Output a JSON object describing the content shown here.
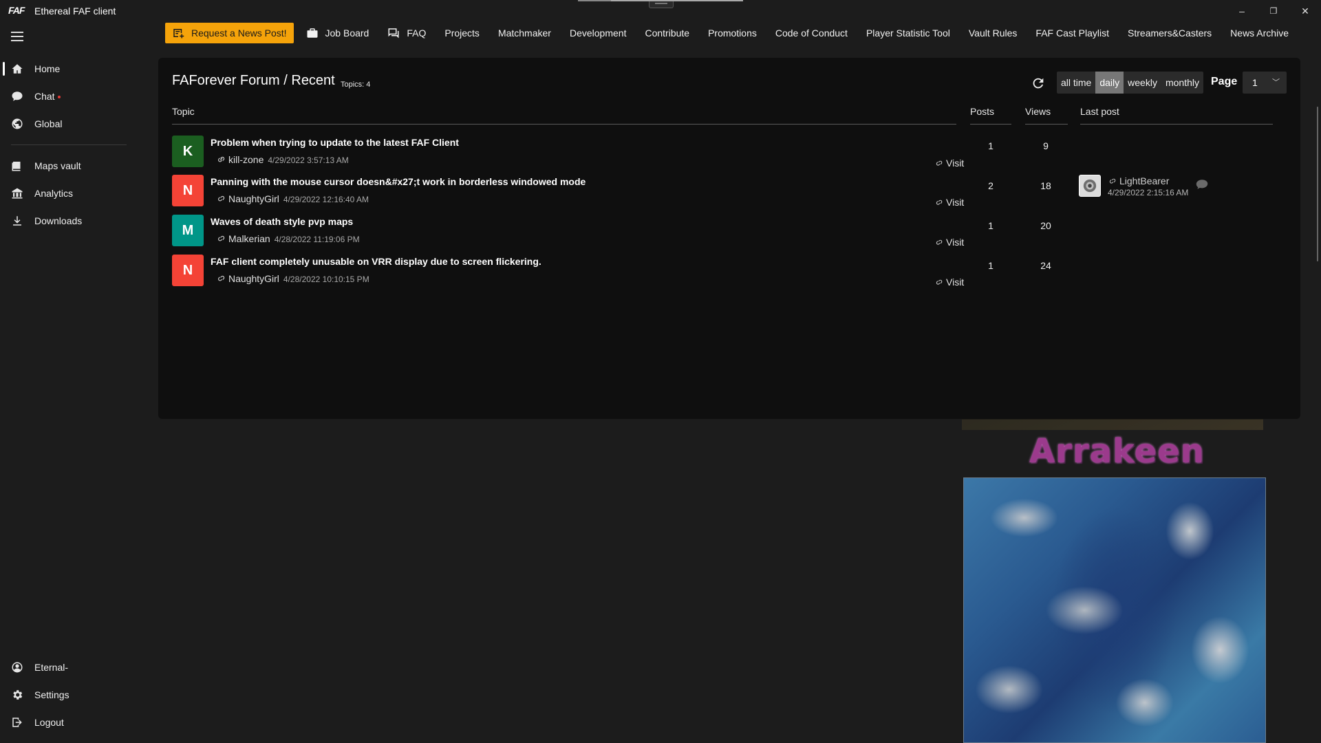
{
  "app": {
    "title": "Ethereal FAF client",
    "logo_text": "FAF"
  },
  "window_controls": {
    "minimize": "–",
    "maximize": "❐",
    "close": "✕"
  },
  "sidebar": {
    "items": [
      {
        "label": "Home",
        "icon": "home-icon"
      },
      {
        "label": "Chat",
        "icon": "chat-icon"
      },
      {
        "label": "Global",
        "icon": "globe-icon"
      },
      {
        "label": "Maps vault",
        "icon": "maps-icon"
      },
      {
        "label": "Analytics",
        "icon": "analytics-icon"
      },
      {
        "label": "Downloads",
        "icon": "download-icon"
      }
    ],
    "bottom_items": [
      {
        "label": "Eternal-",
        "icon": "user-icon"
      },
      {
        "label": "Settings",
        "icon": "gear-icon"
      },
      {
        "label": "Logout",
        "icon": "logout-icon"
      }
    ]
  },
  "topnav": {
    "news_button": "Request a News Post!",
    "tabs": [
      "Job Board",
      "FAQ",
      "Projects",
      "Matchmaker",
      "Development",
      "Contribute",
      "Promotions",
      "Code of Conduct",
      "Player Statistic Tool",
      "Vault Rules",
      "FAF Cast Playlist",
      "Streamers&Casters",
      "News Archive"
    ]
  },
  "forum": {
    "title": "FAForever Forum / Recent",
    "topics_count": "Topics: 4",
    "filters": [
      "all time",
      "daily",
      "weekly",
      "monthly"
    ],
    "selected_filter": "daily",
    "page_label": "Page",
    "page_value": "1",
    "columns": {
      "topic": "Topic",
      "posts": "Posts",
      "views": "Views",
      "last_post": "Last post"
    },
    "visit_label": "Visit",
    "topics": [
      {
        "letter": "K",
        "color": "#1b5e20",
        "title": "Problem when trying to update to the latest FAF Client",
        "author": "kill-zone",
        "time": "4/29/2022 3:57:13 AM",
        "posts": "1",
        "views": "9"
      },
      {
        "letter": "N",
        "color": "#f44336",
        "title": "Panning with the mouse cursor doesn&#x27;t work in borderless windowed mode",
        "author": "NaughtyGirl",
        "time": "4/29/2022 12:16:40 AM",
        "posts": "2",
        "views": "18"
      },
      {
        "letter": "M",
        "color": "#009688",
        "title": "Waves of death style pvp maps",
        "author": "Malkerian",
        "time": "4/28/2022 11:19:06 PM",
        "posts": "1",
        "views": "20"
      },
      {
        "letter": "N",
        "color": "#f44336",
        "title": "FAF client completely unusable on VRR display due to screen flickering.",
        "author": "NaughtyGirl",
        "time": "4/28/2022 10:10:15 PM",
        "posts": "1",
        "views": "24"
      }
    ],
    "last_post": {
      "author": "LightBearer",
      "time": "4/29/2022 2:15:16 AM"
    }
  },
  "map_preview": {
    "name": "Arrakeen"
  },
  "colors": {
    "accent": "#f5a30a",
    "background": "#1c1c1c",
    "panel": "#0f0f0f",
    "filter_selected": "#777777"
  }
}
